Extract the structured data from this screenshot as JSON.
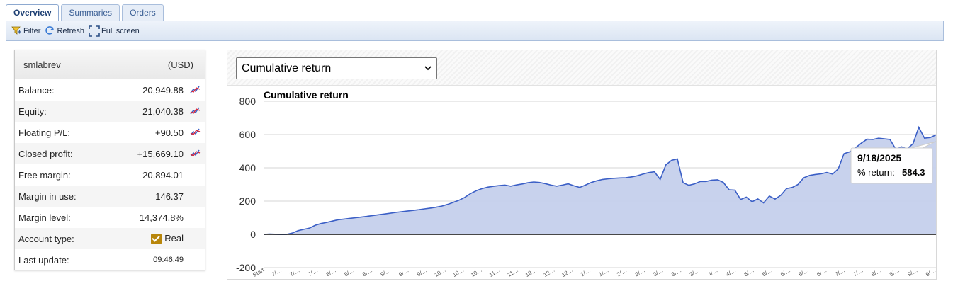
{
  "tabs": [
    {
      "label": "Overview",
      "active": true
    },
    {
      "label": "Summaries",
      "active": false
    },
    {
      "label": "Orders",
      "active": false
    }
  ],
  "toolbar": {
    "filter_label": "Filter",
    "refresh_label": "Refresh",
    "fullscreen_label": "Full screen"
  },
  "account": {
    "name": "smlabrev",
    "currency": "(USD)",
    "rows": [
      {
        "label": "Balance:",
        "value": "20,949.88",
        "chart_icon": true
      },
      {
        "label": "Equity:",
        "value": "21,040.38",
        "chart_icon": true
      },
      {
        "label": "Floating P/L:",
        "value": "+90.50",
        "chart_icon": true
      },
      {
        "label": "Closed profit:",
        "value": "+15,669.10",
        "chart_icon": true
      },
      {
        "label": "Free margin:",
        "value": "20,894.01",
        "chart_icon": false
      },
      {
        "label": "Margin in use:",
        "value": "146.37",
        "chart_icon": false
      },
      {
        "label": "Margin level:",
        "value": "14,374.8%",
        "chart_icon": false
      },
      {
        "label": "Account type:",
        "value": "Real",
        "chart_icon": false,
        "checkbox": true
      },
      {
        "label": "Last update:",
        "value": "09:46:49",
        "chart_icon": false,
        "small": true
      }
    ]
  },
  "chart_select": {
    "value": "Cumulative return"
  },
  "colors": {
    "area_fill": "#c5d0ec",
    "line": "#3b5fc6",
    "accent": "#1d3f73"
  },
  "tooltip": {
    "date": "9/18/2025",
    "label": "% return:",
    "value": "584.3"
  },
  "chart_data": {
    "type": "area",
    "title": "Cumulative return",
    "xlabel": "",
    "ylabel": "",
    "ylim": [
      -200,
      800
    ],
    "yticks": [
      800,
      600,
      400,
      200,
      0,
      -200
    ],
    "grid": true,
    "xticks": [
      "Start",
      "7/…",
      "7/…",
      "7/…",
      "8/…",
      "8/…",
      "8/…",
      "9/…",
      "9/…",
      "9/…",
      "10…",
      "10…",
      "10…",
      "11…",
      "11…",
      "12…",
      "12…",
      "12…",
      "1/…",
      "1/…",
      "2/…",
      "2/…",
      "3/…",
      "3/…",
      "3/…",
      "4/…",
      "4/…",
      "5/…",
      "5/…",
      "6/…",
      "6/…",
      "6/…",
      "7/…",
      "7/…",
      "8/…",
      "8/…",
      "9/…",
      "9/…"
    ],
    "series": [
      {
        "values": [
          0,
          2,
          1,
          0,
          0,
          8,
          22,
          30,
          38,
          55,
          65,
          72,
          80,
          88,
          92,
          96,
          100,
          104,
          108,
          113,
          118,
          122,
          127,
          132,
          136,
          140,
          144,
          148,
          153,
          158,
          163,
          170,
          180,
          192,
          205,
          222,
          245,
          262,
          275,
          284,
          289,
          293,
          296,
          290,
          297,
          303,
          310,
          315,
          312,
          305,
          296,
          290,
          296,
          304,
          292,
          282,
          296,
          312,
          322,
          330,
          334,
          337,
          339,
          340,
          345,
          352,
          362,
          371,
          376,
          330,
          418,
          445,
          453,
          310,
          295,
          304,
          318,
          318,
          326,
          328,
          312,
          268,
          266,
          210,
          224,
          196,
          213,
          189,
          230,
          212,
          235,
          275,
          282,
          300,
          340,
          354,
          360,
          364,
          372,
          362,
          394,
          485,
          496,
          520,
          548,
          572,
          570,
          578,
          574,
          570,
          512,
          526,
          514,
          545,
          644,
          578,
          582,
          598
        ],
        "hover_index": 118,
        "hover_value": 584.3
      }
    ]
  }
}
